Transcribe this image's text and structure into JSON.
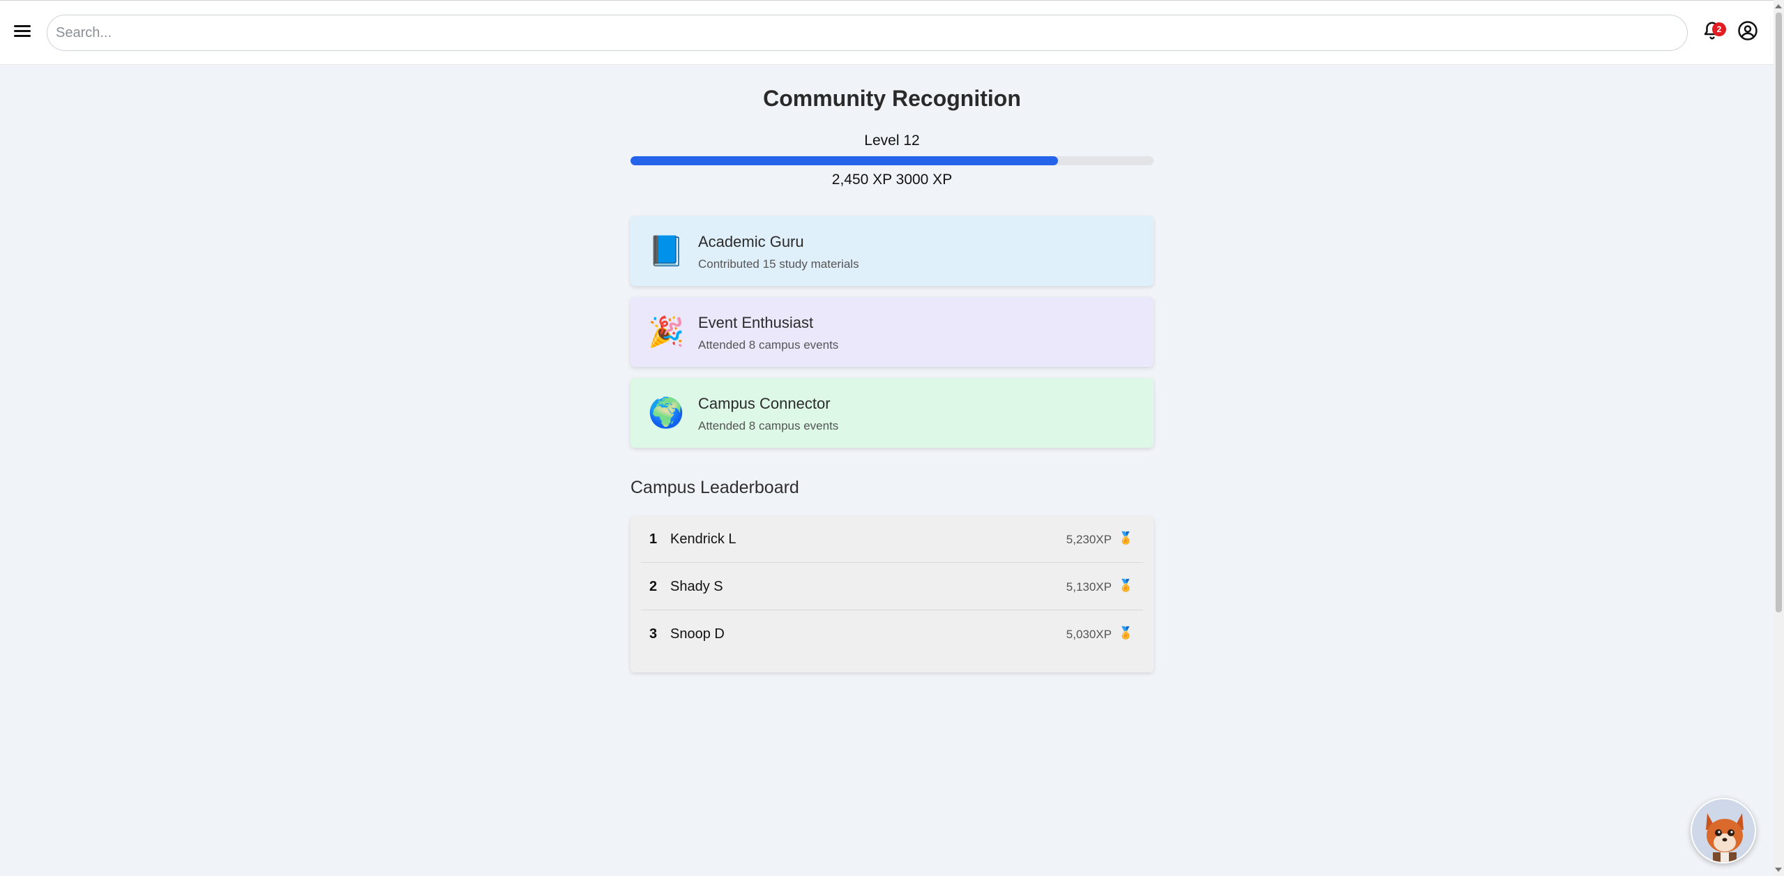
{
  "header": {
    "search_placeholder": "Search...",
    "notifications_count": "2",
    "menu_icon": "hamburger-menu-icon",
    "bell_icon": "bell-icon",
    "user_icon": "user-circle-icon"
  },
  "main": {
    "title": "Community Recognition",
    "level_label": "Level 12",
    "xp_text": "2,450 XP 3000 XP",
    "progress": {
      "current": 2450,
      "max": 3000,
      "fill_color": "#2563eb"
    }
  },
  "badges": [
    {
      "icon": "📘",
      "icon_name": "blue-book-icon",
      "name": "Academic Guru",
      "description": "Contributed 15 study materials",
      "bg": "#e0f0fb"
    },
    {
      "icon": "🎉",
      "icon_name": "party-popper-icon",
      "name": "Event Enthusiast",
      "description": "Attended 8 campus events",
      "bg": "#ebe8fb"
    },
    {
      "icon": "🌍",
      "icon_name": "globe-icon",
      "name": "Campus Connector",
      "description": "Attended 8 campus events",
      "bg": "#ddf8e6"
    }
  ],
  "leaderboard": {
    "title": "Campus Leaderboard",
    "rows": [
      {
        "rank": "1",
        "name": "Kendrick L",
        "xp": "5,230XP",
        "medal": "🏅"
      },
      {
        "rank": "2",
        "name": "Shady S",
        "xp": "5,130XP",
        "medal": "🏅"
      },
      {
        "rank": "3",
        "name": "Snoop D",
        "xp": "5,030XP",
        "medal": "🏅"
      }
    ]
  },
  "assistant": {
    "icon_name": "fox-mascot-avatar"
  }
}
